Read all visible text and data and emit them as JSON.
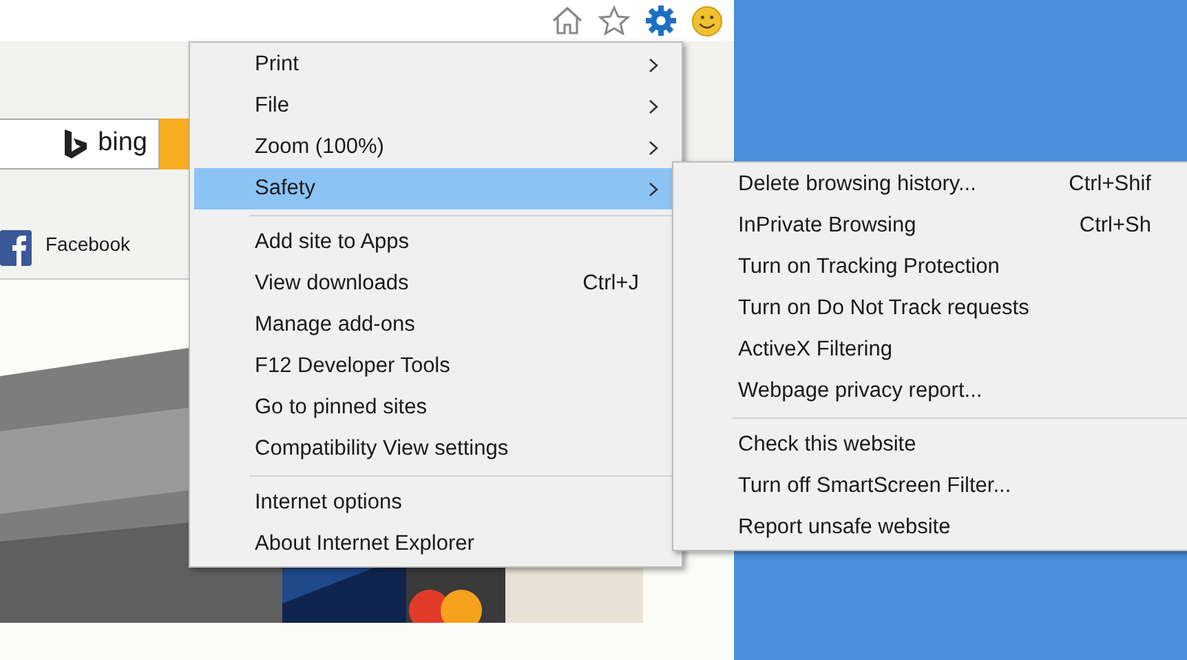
{
  "search": {
    "brand": "bing"
  },
  "favorites": [
    {
      "label": "Facebook"
    }
  ],
  "menu": {
    "items": [
      {
        "kind": "item",
        "label": "Print",
        "submenu": true,
        "selected": false
      },
      {
        "kind": "item",
        "label": "File",
        "submenu": true,
        "selected": false
      },
      {
        "kind": "item",
        "label": "Zoom (100%)",
        "submenu": true,
        "selected": false
      },
      {
        "kind": "item",
        "label": "Safety",
        "submenu": true,
        "selected": true
      },
      {
        "kind": "separator"
      },
      {
        "kind": "item",
        "label": "Add site to Apps",
        "submenu": false,
        "selected": false
      },
      {
        "kind": "item",
        "label": "View downloads",
        "shortcut": "Ctrl+J",
        "submenu": false,
        "selected": false
      },
      {
        "kind": "item",
        "label": "Manage add-ons",
        "submenu": false,
        "selected": false
      },
      {
        "kind": "item",
        "label": "F12 Developer Tools",
        "submenu": false,
        "selected": false
      },
      {
        "kind": "item",
        "label": "Go to pinned sites",
        "submenu": false,
        "selected": false
      },
      {
        "kind": "item",
        "label": "Compatibility View settings",
        "submenu": false,
        "selected": false
      },
      {
        "kind": "separator"
      },
      {
        "kind": "item",
        "label": "Internet options",
        "submenu": false,
        "selected": false
      },
      {
        "kind": "item",
        "label": "About Internet Explorer",
        "submenu": false,
        "selected": false
      }
    ]
  },
  "submenu": {
    "items": [
      {
        "kind": "item",
        "label": "Delete browsing history...",
        "shortcut": "Ctrl+Shif"
      },
      {
        "kind": "item",
        "label": "InPrivate Browsing",
        "shortcut": "Ctrl+Sh"
      },
      {
        "kind": "item",
        "label": "Turn on Tracking Protection"
      },
      {
        "kind": "item",
        "label": "Turn on Do Not Track requests"
      },
      {
        "kind": "item",
        "label": "ActiveX Filtering"
      },
      {
        "kind": "item",
        "label": "Webpage privacy report..."
      },
      {
        "kind": "separator"
      },
      {
        "kind": "item",
        "label": "Check this website"
      },
      {
        "kind": "item",
        "label": "Turn off SmartScreen Filter..."
      },
      {
        "kind": "item",
        "label": "Report unsafe website"
      }
    ]
  }
}
